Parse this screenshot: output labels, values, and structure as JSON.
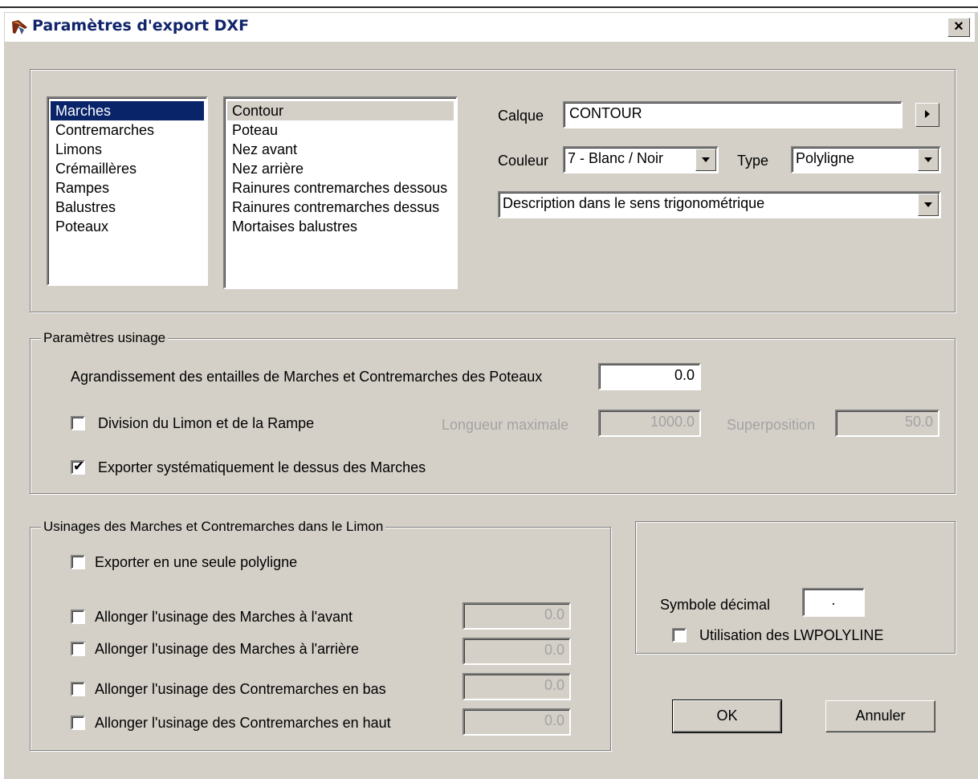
{
  "window": {
    "title": "Paramètres d'export DXF",
    "close_label": "×"
  },
  "elements_list": {
    "items": [
      "Marches",
      "Contremarches",
      "Limons",
      "Crémaillères",
      "Rampes",
      "Balustres",
      "Poteaux"
    ],
    "selected": "Marches"
  },
  "sub_list": {
    "items": [
      "Contour",
      "Poteau",
      "Nez avant",
      "Nez arrière",
      "Rainures contremarches dessous",
      "Rainures contremarches dessus",
      "Mortaises balustres"
    ],
    "selected": "Contour"
  },
  "layer": {
    "label": "Calque",
    "value": "CONTOUR"
  },
  "color": {
    "label": "Couleur",
    "value": "7 - Blanc / Noir"
  },
  "type": {
    "label": "Type",
    "value": "Polyligne"
  },
  "description": {
    "value": "Description dans le sens trigonométrique"
  },
  "machining": {
    "legend": "Paramètres usinage",
    "enlargement_label": "Agrandissement des entailles de Marches et Contremarches des Poteaux",
    "enlargement_value": "0.0",
    "division_label": "Division du Limon et de la Rampe",
    "division_checked": false,
    "max_length_label": "Longueur maximale",
    "max_length_value": "1000.0",
    "overlap_label": "Superposition",
    "overlap_value": "50.0",
    "export_top_label": "Exporter systématiquement le dessus des Marches",
    "export_top_checked": true
  },
  "stringer": {
    "legend": "Usinages des Marches et Contremarches dans le Limon",
    "single_polyline_label": "Exporter en une seule polyligne",
    "rows": [
      {
        "label": "Allonger l'usinage des Marches à l'avant",
        "value": "0.0"
      },
      {
        "label": "Allonger l'usinage des Marches à l'arrière",
        "value": "0.0"
      },
      {
        "label": "Allonger l'usinage des Contremarches en bas",
        "value": "0.0"
      },
      {
        "label": "Allonger l'usinage des Contremarches en haut",
        "value": "0.0"
      }
    ]
  },
  "options": {
    "decimal_label": "Symbole décimal",
    "decimal_value": ".",
    "lwpolyline_label": "Utilisation des LWPOLYLINE"
  },
  "buttons": {
    "ok": "OK",
    "cancel": "Annuler"
  }
}
